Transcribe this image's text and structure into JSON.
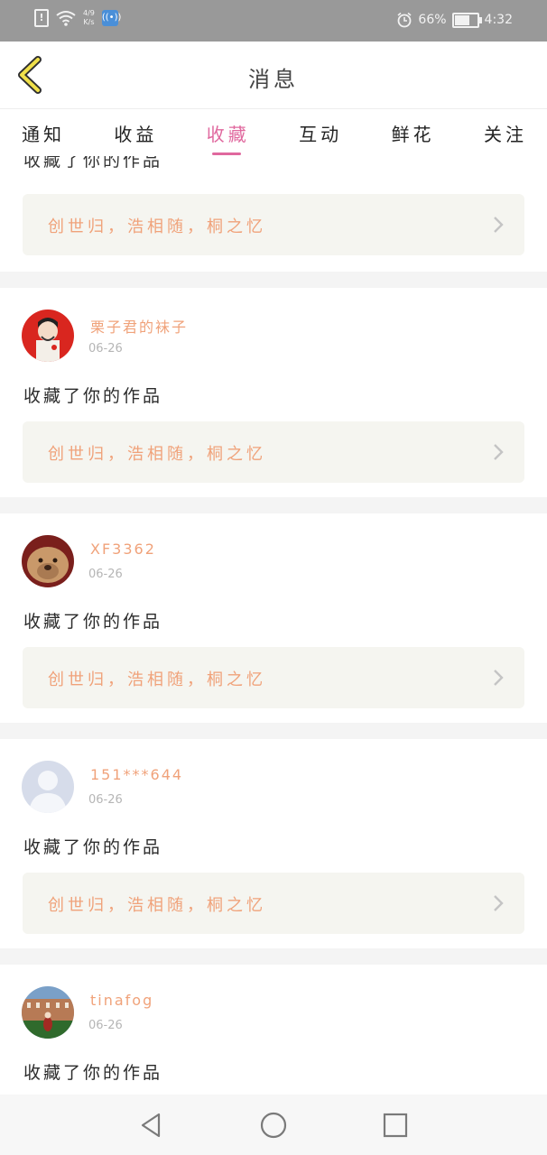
{
  "status_bar": {
    "speed_top": "4/9",
    "speed_bottom": "K/s",
    "battery": "66%",
    "time": "4:32"
  },
  "header": {
    "title": "消息"
  },
  "tabs": [
    {
      "label": "通知",
      "active": false
    },
    {
      "label": "收益",
      "active": false
    },
    {
      "label": "收藏",
      "active": true
    },
    {
      "label": "互动",
      "active": false
    },
    {
      "label": "鲜花",
      "active": false
    },
    {
      "label": "关注",
      "active": false
    }
  ],
  "partial_item": {
    "action": "收藏了你的作品",
    "work": "创世归，浩相随，桐之忆"
  },
  "items": [
    {
      "user": "栗子君的袜子",
      "date": "06-26",
      "action": "收藏了你的作品",
      "work": "创世归，浩相随，桐之忆",
      "avatar": "red-portrait"
    },
    {
      "user": "XF3362",
      "date": "06-26",
      "action": "收藏了你的作品",
      "work": "创世归，浩相随，桐之忆",
      "avatar": "dog"
    },
    {
      "user": "151***644",
      "date": "06-26",
      "action": "收藏了你的作品",
      "work": "创世归，浩相随，桐之忆",
      "avatar": "default-person"
    },
    {
      "user": "tinafog",
      "date": "06-26",
      "action": "收藏了你的作品",
      "avatar": "building"
    }
  ],
  "colors": {
    "accent": "#e0689e",
    "username": "#f0a27a",
    "card_bg": "#f5f5f0",
    "statusbar": "#999999"
  },
  "nav": {
    "back": "triangle-back-icon",
    "home": "circle-home-icon",
    "recent": "square-recent-icon"
  }
}
